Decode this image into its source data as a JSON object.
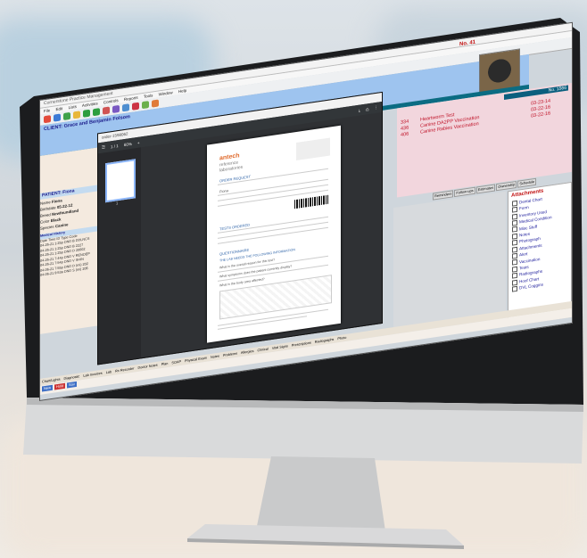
{
  "app": {
    "window_title": "Cornerstone Practice Management",
    "menu": [
      "File",
      "Edit",
      "Lists",
      "Activities",
      "Controls",
      "Reports",
      "Tools",
      "Window",
      "Help"
    ],
    "client_label": "CLIENT: Grace and Benjamin Folsom",
    "visit_no": "No. 41",
    "visit_box": "No. 1566",
    "reminders": [
      {
        "code": "334",
        "name": "Heartworm Test",
        "date": "03-23-14"
      },
      {
        "code": "436",
        "name": "Canine DA2PP Vaccination",
        "date": "03-22-16"
      },
      {
        "code": "406",
        "name": "Canine Rabies Vaccination",
        "date": "03-22-16"
      }
    ],
    "right_tabs": [
      "Reminders",
      "Follow-ups",
      "Estimates",
      "Ownership",
      "Schedule"
    ],
    "attachments": {
      "title": "Attachments",
      "items": [
        "Dental Chart",
        "Form",
        "Inventory Used",
        "Medical Condition",
        "Misc Stuff",
        "Notes",
        "Photograph",
        "Attachments",
        "Alert",
        "Vaccination",
        "Tests",
        "Radiographs",
        "Hoof Chart",
        "DVL Coggins"
      ]
    },
    "patient_header": "PATIENT: Fiona",
    "patient_fields": [
      {
        "label": "Name",
        "value": "Fiona"
      },
      {
        "label": "Birthdate",
        "value": "05-22-12"
      },
      {
        "label": "Breed",
        "value": "Newfoundland"
      },
      {
        "label": "Color",
        "value": "Black"
      },
      {
        "label": "Species",
        "value": "Canine"
      }
    ],
    "history_header": "Medical History",
    "history_cols": [
      "Date",
      "Time",
      "ID",
      "Type",
      "Code"
    ],
    "history_rows": [
      [
        "04-26-21",
        "1:25p",
        "DND",
        "B",
        "DDLNCS"
      ],
      [
        "04-26-21",
        "1:25p",
        "DND",
        "B",
        "2227"
      ],
      [
        "04-26-21",
        "1:25p",
        "DND",
        "D",
        "20002"
      ],
      [
        "04-26-21",
        "7:44p",
        "DND",
        "V",
        "",
        "",
        "RENOEP"
      ],
      [
        "04-26-21",
        "7:54p",
        "DND",
        "V",
        "SHIN"
      ],
      [
        "04-06-21",
        "7:55p",
        "DND",
        "D (mi)",
        "202"
      ],
      [
        "04-06-21",
        "9:53a",
        "DND",
        "S (mi)",
        "206"
      ]
    ],
    "bottom_tabs": [
      "Chart/Lights",
      "Diagnostic",
      "Lab Invoices",
      "Lab",
      "Rx Recorder",
      "Doctor Notes",
      "Plan",
      "SOAP",
      "Physical Exam",
      "Notes",
      "Problems",
      "Allergies",
      "Clinical",
      "Vital Signs",
      "Prescriptions",
      "Radiographs",
      "Photo"
    ],
    "bottom_buttons": [
      "New",
      "Hold",
      "Sav"
    ]
  },
  "pdf": {
    "window_title": "order-1598062",
    "page_indicator": "1 / 1",
    "zoom": "60%",
    "thumb_num": "1",
    "lab_name": "antech",
    "lab_sub1": "reference",
    "lab_sub2": "laboratories",
    "order_heading": "ORDER REQUEST",
    "patient_name": "Fiona",
    "section_tests": "TESTS ORDERED",
    "section_quest": "QUESTIONNAIRE",
    "questionnaire_note": "THE LAB NEEDS THE FOLLOWING INFORMATION",
    "q1": "What is the overall reason for this test?",
    "q2": "What symptoms does the patient currently display?",
    "q3": "What is the body area affected?"
  },
  "colors": {
    "client_strip": "#9ec4ef",
    "teal": "#0b6c83",
    "reminder_red": "#c0152a",
    "pdf_dark": "#2f3134"
  }
}
